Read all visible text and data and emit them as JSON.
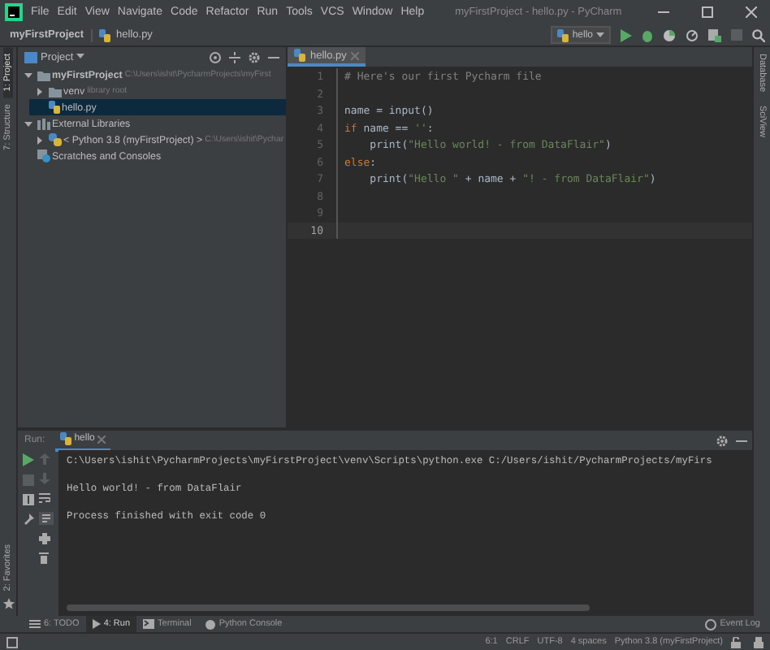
{
  "window": {
    "title": "myFirstProject - hello.py - PyCharm"
  },
  "menu": [
    "File",
    "Edit",
    "View",
    "Navigate",
    "Code",
    "Refactor",
    "Run",
    "Tools",
    "VCS",
    "Window",
    "Help"
  ],
  "breadcrumbs": [
    "myFirstProject",
    "hello.py"
  ],
  "run_config": {
    "label": "hello"
  },
  "left_stripe": [
    {
      "label": "1: Project",
      "selected": true
    },
    {
      "label": "7: Structure",
      "selected": false
    },
    {
      "label": "2: Favorites",
      "selected": false
    }
  ],
  "right_stripe": [
    "Database",
    "SciView"
  ],
  "project_panel": {
    "title": "Project",
    "tree": [
      {
        "label": "myFirstProject",
        "hint": "C:\\Users\\ishit\\PycharmProjects\\myFirst",
        "kind": "folder",
        "expanded": true,
        "selected": false,
        "children": [
          {
            "label": "venv",
            "hint": "library root",
            "kind": "folder",
            "expanded": false,
            "selected": false
          },
          {
            "label": "hello.py",
            "kind": "python",
            "selected": true
          }
        ]
      },
      {
        "label": "External Libraries",
        "kind": "library",
        "expanded": true,
        "selected": false,
        "children": [
          {
            "label": "< Python 3.8 (myFirstProject) >",
            "hint": "C:\\Users\\ishit\\Pychar",
            "kind": "sdk",
            "expanded": false,
            "selected": false
          }
        ]
      },
      {
        "label": "Scratches and Consoles",
        "kind": "scratch",
        "selected": false
      }
    ]
  },
  "editor": {
    "tabs": [
      {
        "label": "hello.py",
        "selected": true
      }
    ],
    "lines": [
      {
        "number": "1",
        "current": false,
        "tokens": [
          {
            "kind": "comment",
            "text": "# Here's our first Pycharm file"
          }
        ]
      },
      {
        "number": "2",
        "current": false
      },
      {
        "number": "3",
        "current": false,
        "tokens": [
          {
            "kind": "plain",
            "text": "name = input()"
          }
        ]
      },
      {
        "number": "4",
        "current": false,
        "tokens": [
          {
            "kind": "keyword",
            "text": "if"
          },
          {
            "kind": "plain",
            "text": " name == "
          },
          {
            "kind": "string",
            "text": "''"
          },
          {
            "kind": "plain",
            "text": ":"
          }
        ]
      },
      {
        "number": "5",
        "current": false,
        "tokens": [
          {
            "kind": "plain",
            "text": "    print("
          },
          {
            "kind": "string",
            "text": "\"Hello world! - from DataFlair\""
          },
          {
            "kind": "plain",
            "text": ")"
          }
        ]
      },
      {
        "number": "6",
        "current": false,
        "tokens": [
          {
            "kind": "keyword",
            "text": "else"
          },
          {
            "kind": "plain",
            "text": ":"
          }
        ]
      },
      {
        "number": "7",
        "current": false,
        "tokens": [
          {
            "kind": "plain",
            "text": "    print("
          },
          {
            "kind": "string",
            "text": "\"Hello \""
          },
          {
            "kind": "plain",
            "text": " + name + "
          },
          {
            "kind": "string",
            "text": "\"! - from DataFlair\""
          },
          {
            "kind": "plain",
            "text": ")"
          }
        ]
      },
      {
        "number": "8",
        "current": false
      },
      {
        "number": "9",
        "current": false
      },
      {
        "number": "10",
        "current": true
      }
    ]
  },
  "run": {
    "label": "Run:",
    "tabs": [
      {
        "label": "hello",
        "selected": true
      }
    ],
    "output": [
      "C:\\Users\\ishit\\PycharmProjects\\myFirstProject\\venv\\Scripts\\python.exe C:/Users/ishit/PycharmProjects/myFirs",
      "Hello world! - from DataFlair",
      "Process finished with exit code 0"
    ]
  },
  "tool_tabs": [
    {
      "label": "6: TODO",
      "kind": "todo",
      "selected": false
    },
    {
      "label": "4: Run",
      "kind": "run",
      "selected": true
    },
    {
      "label": "Terminal",
      "kind": "terminal",
      "selected": false
    },
    {
      "label": "Python Console",
      "kind": "console",
      "selected": false
    }
  ],
  "event_log": "Event Log",
  "status_bar": [
    "6:1",
    "CRLF",
    "UTF-8",
    "4 spaces",
    "Python 3.8 (myFirstProject)"
  ]
}
